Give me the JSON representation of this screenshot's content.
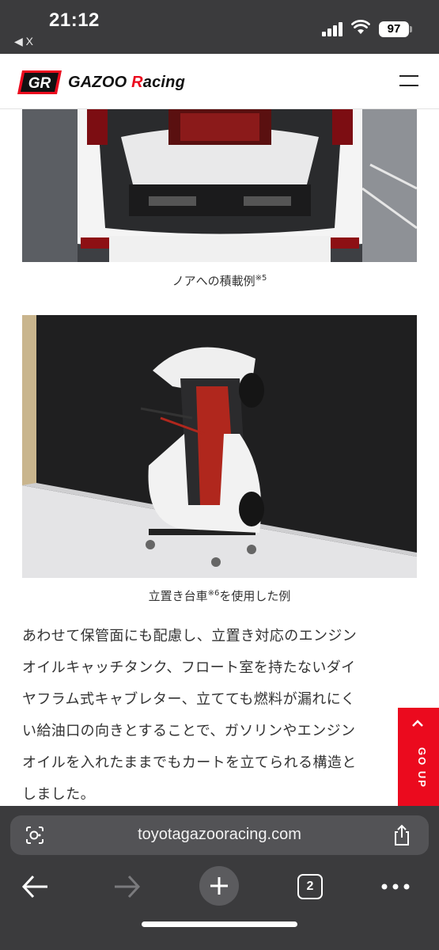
{
  "status_bar": {
    "time": "21:12",
    "back_label": "◀ X",
    "battery": "97"
  },
  "header": {
    "logo_mark": "GR",
    "logo_text_prefix": "GAZOO ",
    "logo_text_r": "R",
    "logo_text_suffix": "acing",
    "menu_icon": "hamburger-menu-icon"
  },
  "article": {
    "figure1": {
      "caption_main": "ノアへの積載例",
      "caption_sup": "※5"
    },
    "figure2": {
      "caption_pre": "立置き台車",
      "caption_sup": "※6",
      "caption_post": "を使用した例"
    },
    "paragraph_lines": [
      "あわせて保管面にも配慮し、立置き対応のエンジン",
      "オイルキャッチタンク、フロート室を持たないダイ",
      "ヤフラム式キャブレター、立てても燃料が漏れにく",
      "い給油口の向きとすることで、ガソリンやエンジン",
      "オイルを入れたままでもカートを立てられる構造と",
      "しました。"
    ]
  },
  "go_up": {
    "label": "GO UP"
  },
  "browser": {
    "url": "toyotagazooracing.com",
    "tab_count": "2",
    "icons": [
      "lens-icon",
      "share-icon",
      "back-arrow-icon",
      "forward-arrow-icon",
      "plus-icon",
      "tabs-icon",
      "more-icon"
    ]
  },
  "colors": {
    "brand_red": "#eb0a1e",
    "browser_chrome": "#3b3b3d"
  }
}
